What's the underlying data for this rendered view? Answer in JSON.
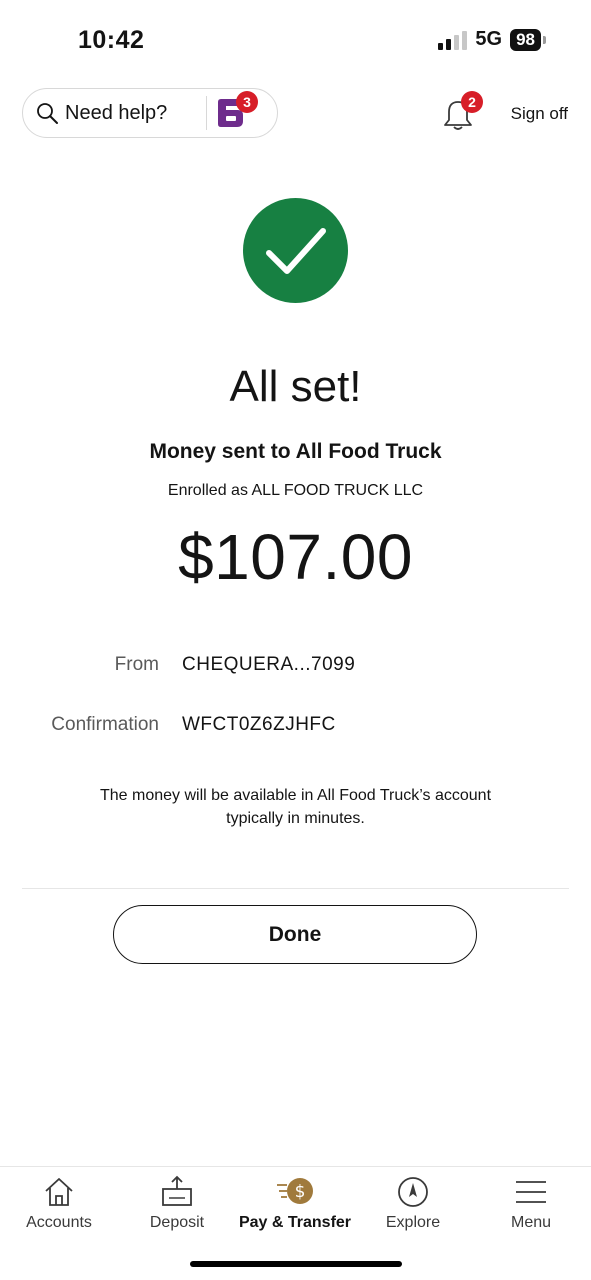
{
  "status_bar": {
    "time": "10:42",
    "network": "5G",
    "battery": "98"
  },
  "header": {
    "help_label": "Need help?",
    "fargo_badge_count": "3",
    "notifications_badge_count": "2",
    "sign_off_label": "Sign off"
  },
  "confirmation": {
    "title": "All set!",
    "subtitle": "Money sent to All Food Truck",
    "enrolled_text": "Enrolled as ALL FOOD TRUCK LLC",
    "amount": "$107.00",
    "details": [
      {
        "label": "From",
        "value": "CHEQUERA...7099"
      },
      {
        "label": "Confirmation",
        "value": "WFCT0Z6ZJHFC"
      }
    ],
    "note": "The money will be available in All Food Truck’s account typically in minutes.",
    "done_label": "Done"
  },
  "bottom_nav": {
    "items": [
      {
        "label": "Accounts",
        "icon": "home-icon"
      },
      {
        "label": "Deposit",
        "icon": "deposit-icon"
      },
      {
        "label": "Pay & Transfer",
        "icon": "pay-transfer-icon",
        "active": true
      },
      {
        "label": "Explore",
        "icon": "compass-icon"
      },
      {
        "label": "Menu",
        "icon": "menu-icon"
      }
    ]
  },
  "colors": {
    "success_green": "#178042",
    "badge_red": "#d71e28",
    "fargo_purple": "#6e2c8c",
    "accent_gold": "#a07a3c"
  }
}
